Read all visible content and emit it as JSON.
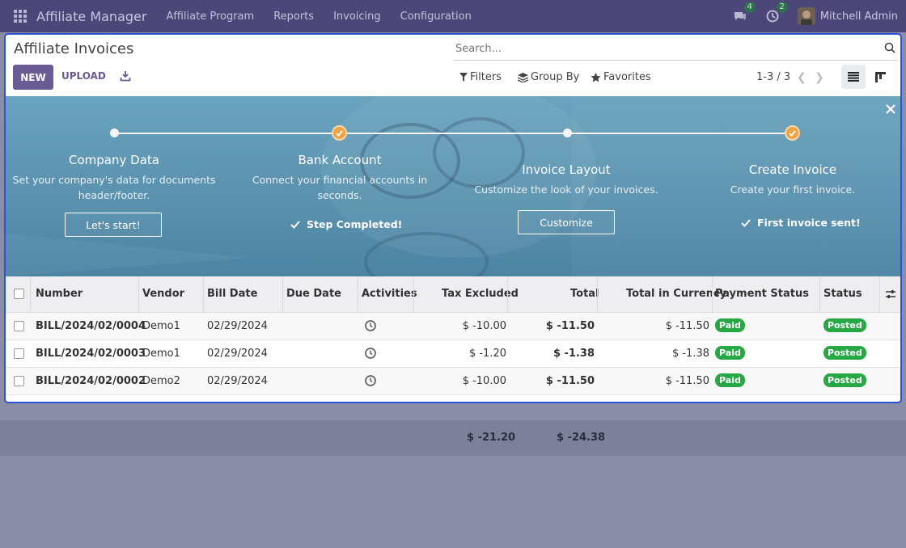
{
  "navbar": {
    "brand": "Affiliate Manager",
    "menus": [
      "Affiliate Program",
      "Reports",
      "Invoicing",
      "Configuration"
    ],
    "messages_count": "4",
    "activities_count": "2",
    "user": "Mitchell Admin"
  },
  "header": {
    "title": "Affiliate Invoices",
    "search_placeholder": "Search...",
    "new_label": "NEW",
    "upload_label": "UPLOAD",
    "filters_label": "Filters",
    "groupby_label": "Group By",
    "favorites_label": "Favorites",
    "pager": "1-3 / 3"
  },
  "banner": {
    "steps": [
      {
        "title": "Company Data",
        "desc": "Set your company's data for documents header/footer.",
        "button": "Let's start!"
      },
      {
        "title": "Bank Account",
        "desc": "Connect your financial accounts in seconds.",
        "done": "Step Completed!"
      },
      {
        "title": "Invoice Layout",
        "desc": "Customize the look of your invoices.",
        "button": "Customize"
      },
      {
        "title": "Create Invoice",
        "desc": "Create your first invoice.",
        "done": "First invoice sent!"
      }
    ]
  },
  "table": {
    "columns": [
      "Number",
      "Vendor",
      "Bill Date",
      "Due Date",
      "Activities",
      "Tax Excluded",
      "Total",
      "Total in Currency",
      "Payment Status",
      "Status"
    ],
    "rows": [
      {
        "number": "BILL/2024/02/0004",
        "vendor": "Demo1",
        "bill_date": "02/29/2024",
        "due_date": "",
        "tax_excluded": "$ -10.00",
        "total": "$ -11.50",
        "total_currency": "$ -11.50",
        "payment_status": "Paid",
        "status": "Posted"
      },
      {
        "number": "BILL/2024/02/0003",
        "vendor": "Demo1",
        "bill_date": "02/29/2024",
        "due_date": "",
        "tax_excluded": "$ -1.20",
        "total": "$ -1.38",
        "total_currency": "$ -1.38",
        "payment_status": "Paid",
        "status": "Posted"
      },
      {
        "number": "BILL/2024/02/0002",
        "vendor": "Demo2",
        "bill_date": "02/29/2024",
        "due_date": "",
        "tax_excluded": "$ -10.00",
        "total": "$ -11.50",
        "total_currency": "$ -11.50",
        "payment_status": "Paid",
        "status": "Posted"
      }
    ],
    "totals": {
      "tax_excluded": "$ -21.20",
      "total": "$ -24.38"
    }
  },
  "colors": {
    "navbar": "#4d4779",
    "primary": "#6b5b95",
    "focus_border": "#2e52d6",
    "success": "#28a745",
    "step_check": "#f1a445"
  }
}
